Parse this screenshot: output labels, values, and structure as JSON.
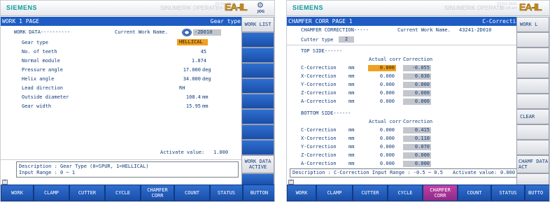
{
  "panel1": {
    "brand": "SIEMENS",
    "product": "SINUMERIK OPERATE",
    "date": "23-02-2021",
    "time": "08:37 am",
    "logo": "EA-IL",
    "jog": "JOG",
    "page_title": "WORK 1 PAGE",
    "gear_type_header": "Gear type",
    "work_data_label": "WORK DATA----------",
    "current_work_name_label": "Current Work Name.",
    "current_work_name_value": "-2D010",
    "fields": [
      {
        "label": "Gear type",
        "value": "HELLICAL",
        "unit": ""
      },
      {
        "label": "No. of teeth",
        "value": "45",
        "unit": ""
      },
      {
        "label": "Normal module",
        "value": "1.874",
        "unit": ""
      },
      {
        "label": "Pressure angle",
        "value": "17.000",
        "unit": "deg"
      },
      {
        "label": "Helix angle",
        "value": "34.000",
        "unit": "deg"
      },
      {
        "label": "Lead direction",
        "value": "RH",
        "unit": ""
      },
      {
        "label": "Outside diameter",
        "value": "108.4",
        "unit": "mm"
      },
      {
        "label": "Gear width",
        "value": "15.95",
        "unit": "mm"
      }
    ],
    "activate_value_label": "Activate value:",
    "activate_value": "1.000",
    "description_line1": "Description : Gear Type (0=SPUR, 1=HELLICAL)",
    "description_line2": "Input Range : 0 ~ 1",
    "vertical_buttons": [
      "WORK LIST",
      "",
      "",
      "",
      "",
      "",
      "",
      "",
      "",
      "WORK DATA ACTIVE",
      ""
    ],
    "horizontal_buttons": [
      "WORK",
      "CLAMP",
      "CUTTER",
      "CYCLE",
      "CHAMFER CORR",
      "COUNT",
      "STATUS",
      "BUTTON"
    ]
  },
  "panel2": {
    "brand": "SIEMENS",
    "product": "SINUMERIK OPERATE",
    "date": "23-02-2021",
    "time": "08:38 am",
    "logo": "EA-IL",
    "page_title": "CHAMFER CORR PAGE 1",
    "header_right": "C-Correction",
    "chamfer_label": "CHAMFER CORRECTION-----",
    "current_work_name_label": "Current Work Name.",
    "current_work_name_value": "43241-2D010",
    "cutter_type_label": "Cutter type",
    "cutter_type_value": "2",
    "top_side_label": "TOP SIDE------",
    "bottom_side_label": "BOTTOM SIDE------",
    "col_actual": "Actual corr",
    "col_correction": "Correction",
    "top_rows": [
      {
        "axis": "C-Correction",
        "unit": "mm",
        "actual": "0.000",
        "corr": "-0.055"
      },
      {
        "axis": "X-Correction",
        "unit": "mm",
        "actual": "0.000",
        "corr": "0.030"
      },
      {
        "axis": "Y-Correction",
        "unit": "mm",
        "actual": "0.000",
        "corr": "0.000"
      },
      {
        "axis": "Z-Correction",
        "unit": "mm",
        "actual": "0.000",
        "corr": "0.000"
      },
      {
        "axis": "A-Correction",
        "unit": "mm",
        "actual": "0.000",
        "corr": "0.000"
      }
    ],
    "bottom_rows": [
      {
        "axis": "C-Correction",
        "unit": "mm",
        "actual": "0.000",
        "corr": "0.415"
      },
      {
        "axis": "X-Correction",
        "unit": "mm",
        "actual": "0.000",
        "corr": "0.110"
      },
      {
        "axis": "Y-Correction",
        "unit": "mm",
        "actual": "0.000",
        "corr": "0.070"
      },
      {
        "axis": "Z-Correction",
        "unit": "mm",
        "actual": "0.000",
        "corr": "0.000"
      },
      {
        "axis": "A-Correction",
        "unit": "mm",
        "actual": "0.000",
        "corr": "0.000"
      }
    ],
    "description": "Description : C-Correction  Input Range : -0.5 ~ 0.5",
    "activate_value_label": "Activate value:",
    "activate_value": "0.000",
    "vertical_buttons": [
      "WORK L",
      "",
      "",
      "",
      "",
      "",
      "CLEAR",
      "",
      "",
      "CHAMF DATA ACT",
      ""
    ],
    "horizontal_buttons": [
      "WORK",
      "CLAMP",
      "CUTTER",
      "CYCLE",
      "CHAMFER CORR",
      "COUNT",
      "STATUS",
      "BUTTO"
    ]
  }
}
